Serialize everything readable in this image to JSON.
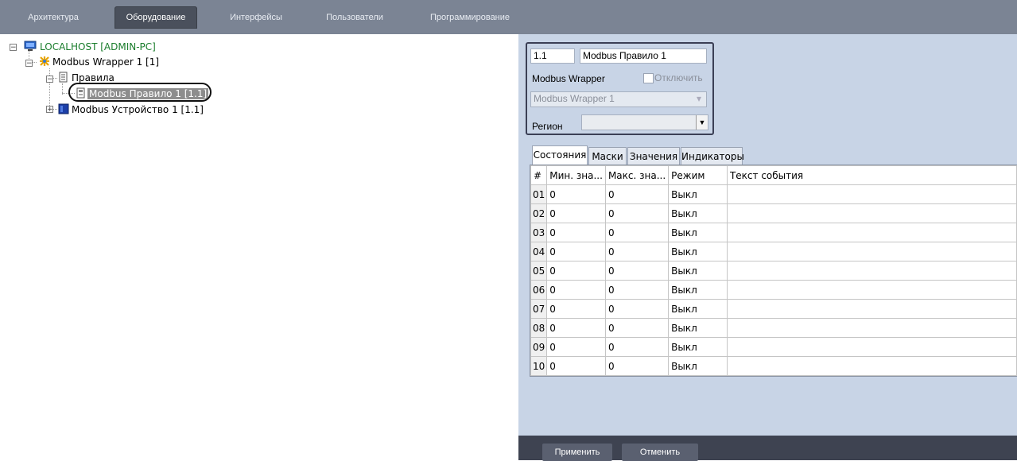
{
  "top_tabs": [
    "Архитектура",
    "Оборудование",
    "Интерфейсы",
    "Пользователи",
    "Программирование"
  ],
  "active_tab": "Оборудование",
  "tree": {
    "root": "LOCALHOST [ADMIN-PC]",
    "wrapper": "Modbus Wrapper 1 [1]",
    "rules_folder": "Правила",
    "rule": "Modbus Правило 1 [1.1]",
    "device": "Modbus Устройство 1 [1.1]"
  },
  "props": {
    "id": "1.1",
    "name": "Modbus Правило 1",
    "parent_type": "Modbus Wrapper",
    "disable_label": "Отключить",
    "parent_value": "Modbus Wrapper 1",
    "region_label": "Регион",
    "region_value": ""
  },
  "tabs": [
    "Состояния",
    "Маски",
    "Значения",
    "Индикаторы"
  ],
  "grid": {
    "headers": [
      "#",
      "Мин. зна...",
      "Макс. зна...",
      "Режим",
      "Текст события"
    ],
    "rows": [
      [
        "01",
        "0",
        "0",
        "Выкл",
        ""
      ],
      [
        "02",
        "0",
        "0",
        "Выкл",
        ""
      ],
      [
        "03",
        "0",
        "0",
        "Выкл",
        ""
      ],
      [
        "04",
        "0",
        "0",
        "Выкл",
        ""
      ],
      [
        "05",
        "0",
        "0",
        "Выкл",
        ""
      ],
      [
        "06",
        "0",
        "0",
        "Выкл",
        ""
      ],
      [
        "07",
        "0",
        "0",
        "Выкл",
        ""
      ],
      [
        "08",
        "0",
        "0",
        "Выкл",
        ""
      ],
      [
        "09",
        "0",
        "0",
        "Выкл",
        ""
      ],
      [
        "10",
        "0",
        "0",
        "Выкл",
        ""
      ]
    ]
  },
  "buttons": {
    "apply": "Применить",
    "cancel": "Отменить"
  },
  "icons": {
    "root": "computer-icon",
    "wrapper": "modbus-wrapper-icon",
    "rules": "rules-folder-icon",
    "rule": "rule-icon",
    "device": "device-icon"
  },
  "colors": {
    "topbar": "#7b8494",
    "panel": "#c8d4e6",
    "bottombar": "#3e4351",
    "tree_root": "#1a7d2c"
  }
}
